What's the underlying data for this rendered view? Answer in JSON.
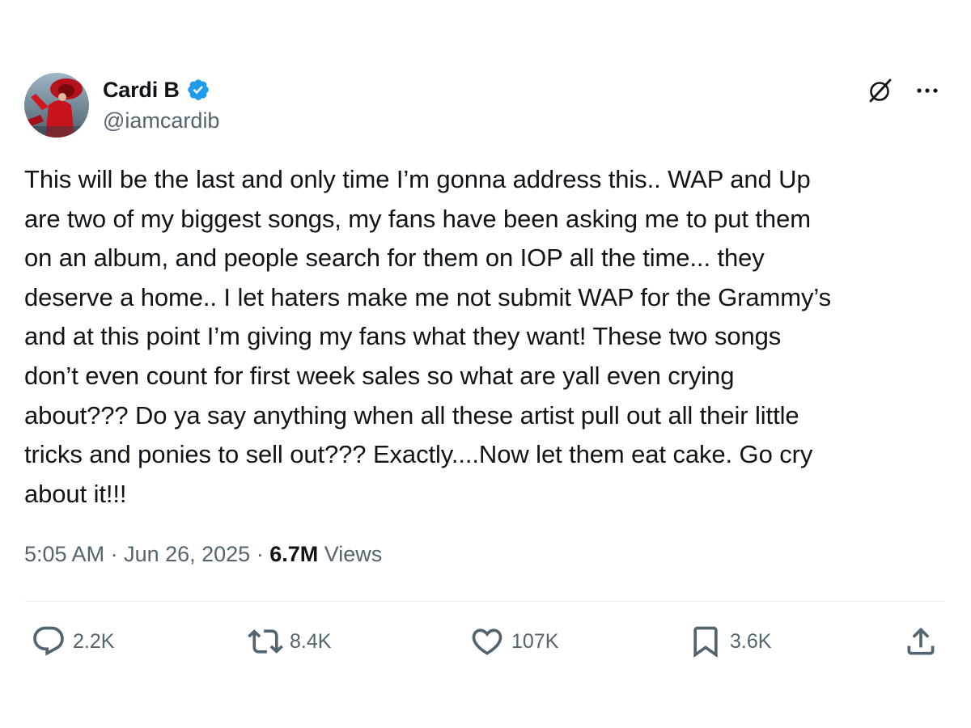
{
  "author": {
    "display_name": "Cardi B",
    "handle": "@iamcardib",
    "verified": true
  },
  "tweet": {
    "text": "This will be the last and only time I’m gonna address this.. WAP and Up\nare two of my biggest songs, my fans have been asking me to put them\non an album,  and people search for them on IOP all the time... they\ndeserve a home.. I let haters make me not submit WAP for the Grammy’s\nand at this point I’m giving my fans what they want! These two songs\ndon’t even count for first week sales so what are yall even crying\nabout??? Do ya say anything when all these artist pull out all their little\ntricks and ponies to sell out??? Exactly....Now let them eat cake. Go cry\nabout it!!!",
    "time": "5:05 AM",
    "separator": " · ",
    "date": "Jun 26, 2025",
    "views_count": "6.7M",
    "views_label": " Views"
  },
  "actions": {
    "replies": "2.2K",
    "reposts": "8.4K",
    "likes": "107K",
    "bookmarks": "3.6K"
  },
  "icons": {
    "verified": "verified-badge-icon",
    "grok": "grok-icon",
    "more": "more-icon",
    "reply": "reply-icon",
    "repost": "retweet-icon",
    "like": "heart-icon",
    "bookmark": "bookmark-icon",
    "share": "share-icon"
  },
  "colors": {
    "text": "#0f1419",
    "secondary": "#536471",
    "verified": "#1d9bf0",
    "divider": "#eff3f4"
  }
}
